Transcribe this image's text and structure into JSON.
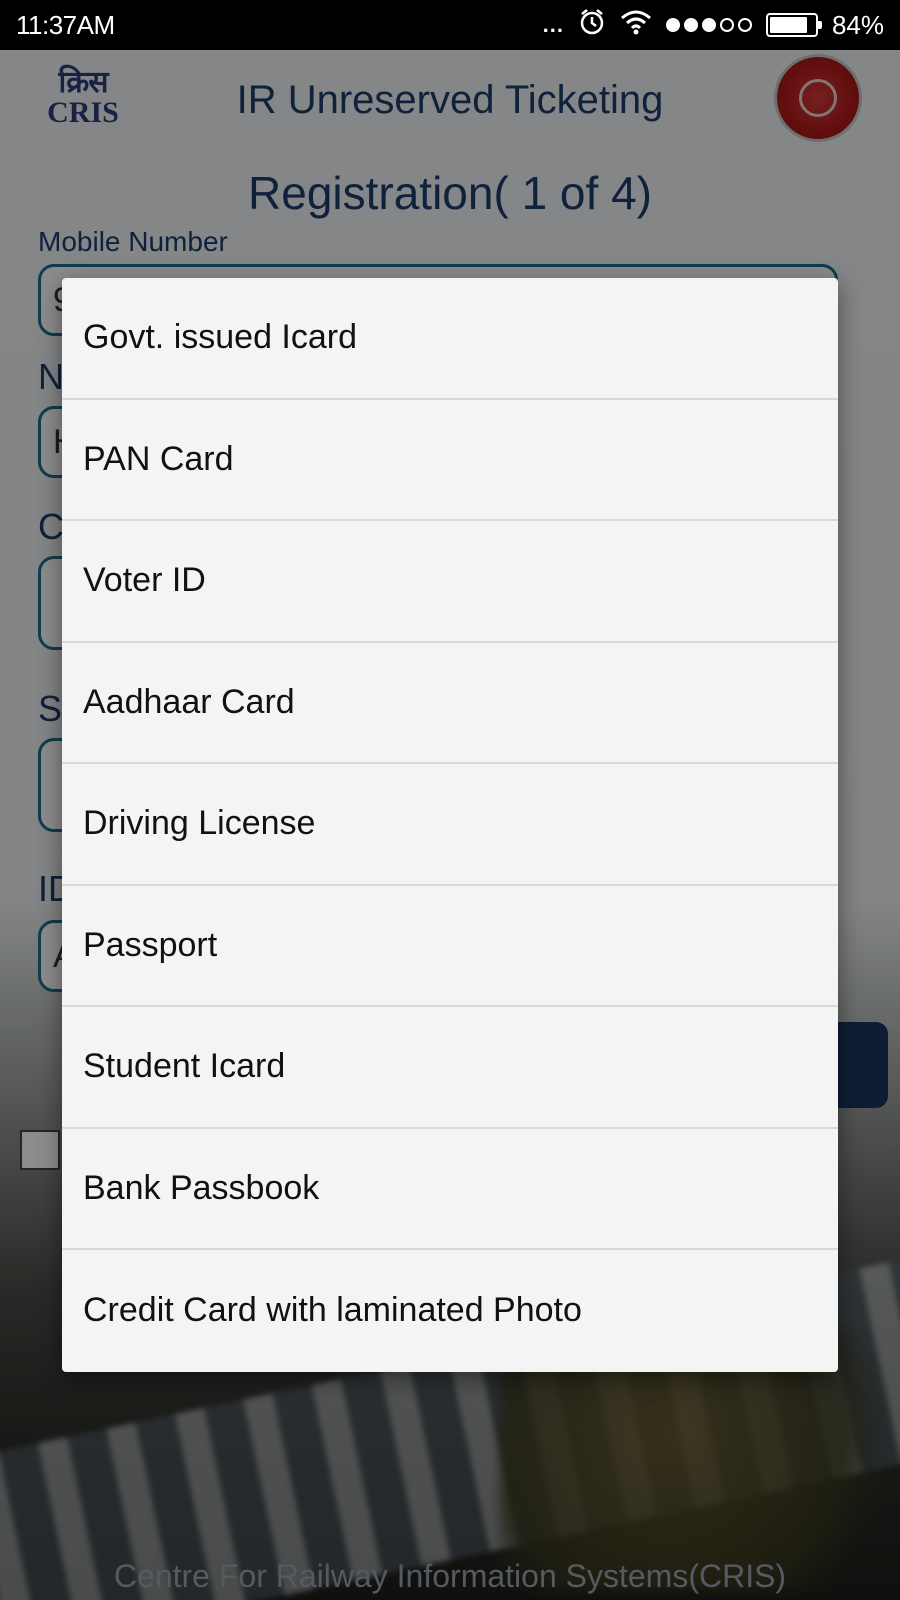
{
  "status_bar": {
    "time": "11:37AM",
    "more_indicator": "...",
    "battery_percent": "84%",
    "battery_level": 0.84,
    "signal_bars_filled": 3,
    "signal_bars_total": 5
  },
  "header": {
    "title": "IR Unreserved Ticketing",
    "left_logo_glyph": "क्रिस",
    "left_logo_text": "CRIS",
    "right_logo": "indian-railways-emblem"
  },
  "form": {
    "heading": "Registration( 1 of 4)",
    "mobile_label": "Mobile Number",
    "mobile_value_visible": "9",
    "name_label_visible": "N",
    "name_value_visible": "H",
    "field3_label_visible": "C",
    "field4_label_visible": "S",
    "id_label_visible": "ID",
    "id_value_visible": "A"
  },
  "id_type_dialog": {
    "options": [
      "Govt. issued Icard",
      "PAN Card",
      "Voter ID",
      "Aadhaar Card",
      "Driving License",
      "Passport",
      "Student Icard",
      "Bank Passbook",
      "Credit Card with laminated Photo"
    ]
  },
  "footer": {
    "text": "Centre For Railway Information Systems(CRIS)"
  },
  "colors": {
    "primary_text": "#1e3d6e",
    "input_border": "#1f6f8a",
    "button": "#1b3560",
    "dialog_bg": "#f4f4f4",
    "divider": "#d8d8d8"
  }
}
